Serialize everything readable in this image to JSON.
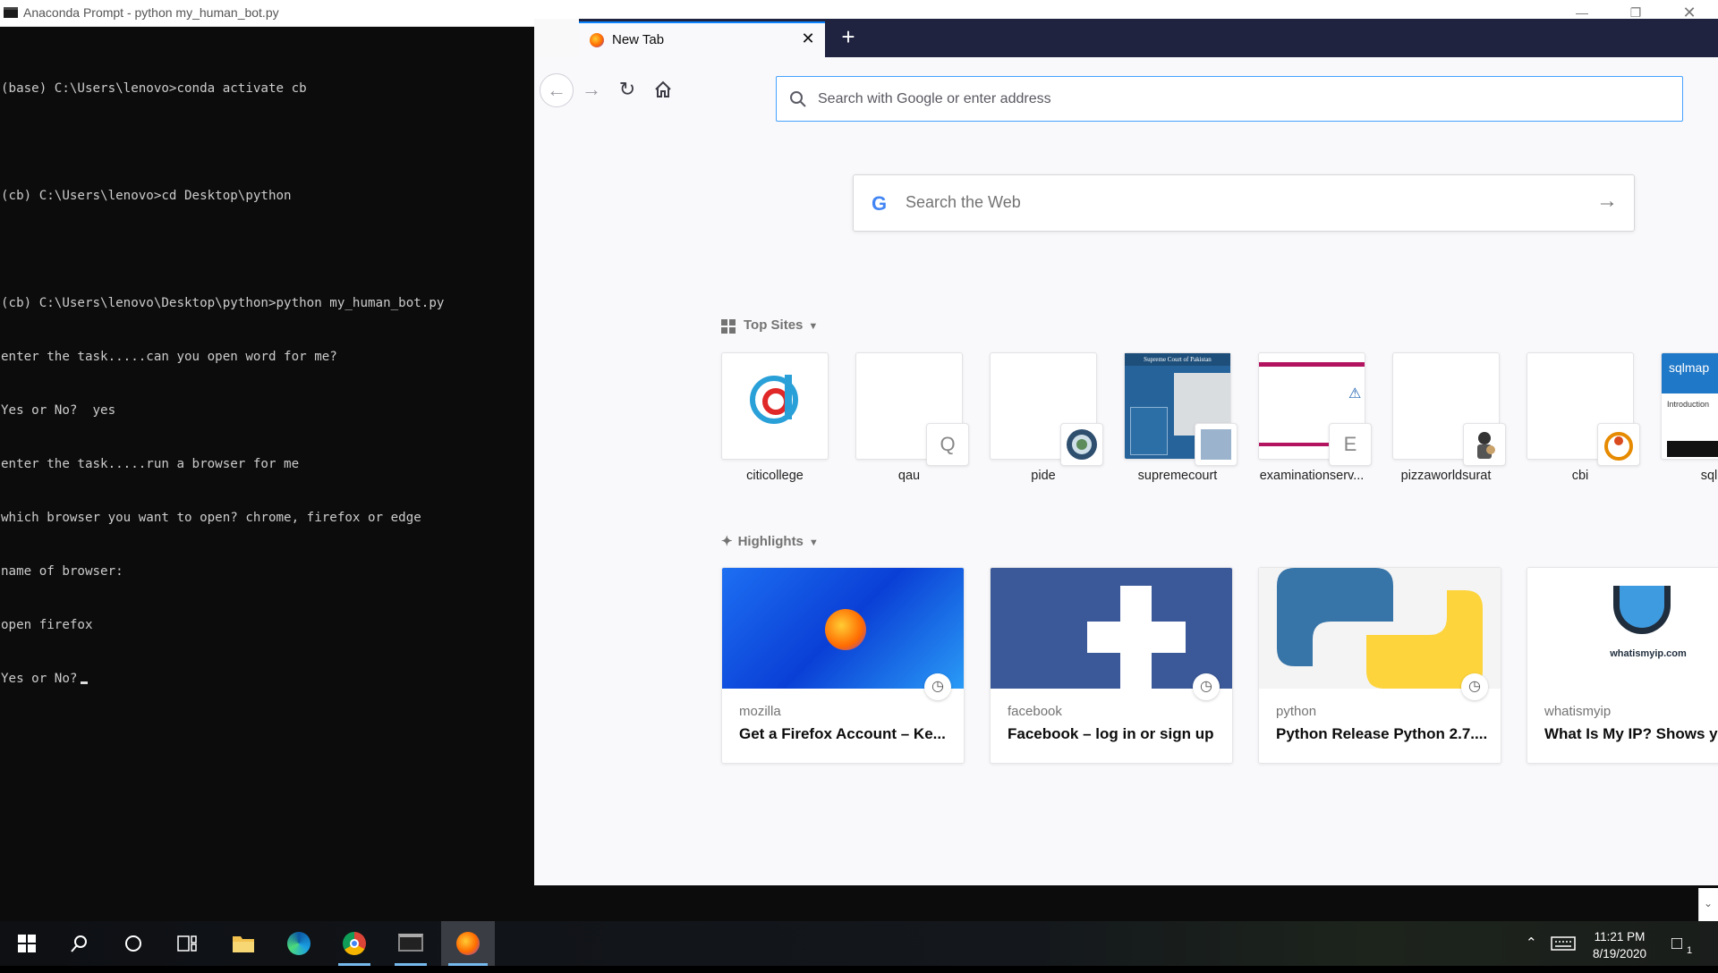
{
  "console": {
    "title": "Anaconda Prompt - python  my_human_bot.py",
    "lines": [
      "(base) C:\\Users\\lenovo>conda activate cb",
      "",
      "(cb) C:\\Users\\lenovo>cd Desktop\\python",
      "",
      "(cb) C:\\Users\\lenovo\\Desktop\\python>python my_human_bot.py",
      "enter the task.....can you open word for me?",
      "Yes or No?  yes",
      "enter the task.....run a browser for me",
      "which browser you want to open? chrome, firefox or edge",
      "name of browser:",
      "open firefox",
      "Yes or No?"
    ],
    "window_controls": [
      "minimize-icon",
      "restore-icon",
      "close-icon"
    ]
  },
  "firefox": {
    "tab_title": "New Tab",
    "url_placeholder": "Search with Google or enter address",
    "web_search_placeholder": "Search the Web",
    "top_sites_label": "Top Sites",
    "highlights_label": "Highlights",
    "top_sites": [
      {
        "name": "citicollege",
        "overlay": ""
      },
      {
        "name": "qau",
        "overlay": "Q"
      },
      {
        "name": "pide",
        "overlay": ""
      },
      {
        "name": "supremecourt",
        "overlay": ""
      },
      {
        "name": "examinationserv...",
        "overlay": "E"
      },
      {
        "name": "pizzaworldsurat",
        "overlay": ""
      },
      {
        "name": "cbi",
        "overlay": ""
      },
      {
        "name": "sqlm",
        "overlay": ""
      }
    ],
    "highlights": [
      {
        "site": "mozilla",
        "title": "Get a Firefox Account – Ke..."
      },
      {
        "site": "facebook",
        "title": "Facebook – log in or sign up"
      },
      {
        "site": "python",
        "title": "Python Release Python 2.7...."
      },
      {
        "site": "whatismyip",
        "title": "What Is My IP? Shows yo",
        "logo_text": "whatismyip.com"
      }
    ],
    "supremecourt_header": "Supreme Court of Pakistan",
    "sqlmap_logo": "sqlmap",
    "sqlmap_intro": "Introduction"
  },
  "taskbar": {
    "time": "11:21 PM",
    "date": "8/19/2020",
    "notification_count": "1",
    "accent_color": "#76b9ed"
  }
}
